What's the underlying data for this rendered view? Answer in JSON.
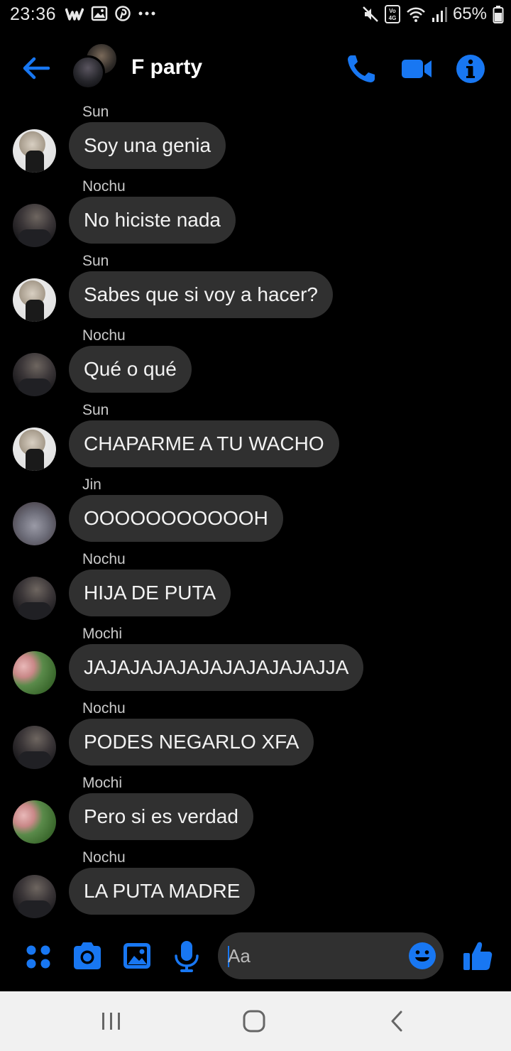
{
  "status_bar": {
    "time": "23:36",
    "battery_text": "65%",
    "left_icons": [
      "wattpad-icon",
      "gallery-icon",
      "pinterest-icon",
      "more-dots-icon"
    ],
    "right_icons": [
      "mute-icon",
      "volte-4g-icon",
      "wifi-icon",
      "signal-icon",
      "battery-icon"
    ]
  },
  "header": {
    "title": "F party",
    "icons": [
      "back-arrow-icon",
      "phone-icon",
      "video-icon",
      "info-icon"
    ]
  },
  "colors": {
    "accent": "#1877f2",
    "background": "#000000",
    "bubble": "#303030",
    "sender_label": "#c9c9c9",
    "navbar": "#f1f1f1"
  },
  "messages": [
    {
      "sender": "Sun",
      "text": "Soy una genia",
      "avatar": "sun"
    },
    {
      "sender": "Nochu",
      "text": "No hiciste nada",
      "avatar": "nochu"
    },
    {
      "sender": "Sun",
      "text": "Sabes que si voy a hacer?",
      "avatar": "sun"
    },
    {
      "sender": "Nochu",
      "text": "Qué o qué",
      "avatar": "nochu"
    },
    {
      "sender": "Sun",
      "text": "CHAPARME A TU WACHO",
      "avatar": "sun"
    },
    {
      "sender": "Jin",
      "text": "OOOOOOOOOOOH",
      "avatar": "jin"
    },
    {
      "sender": "Nochu",
      "text": "HIJA DE PUTA",
      "avatar": "nochu"
    },
    {
      "sender": "Mochi",
      "text": "JAJAJAJAJAJAJAJAJAJAJJA",
      "avatar": "mochi"
    },
    {
      "sender": "Nochu",
      "text": "PODES NEGARLO XFA",
      "avatar": "nochu"
    },
    {
      "sender": "Mochi",
      "text": "Pero si es verdad",
      "avatar": "mochi"
    },
    {
      "sender": "Nochu",
      "text": "LA PUTA MADRE",
      "avatar": "nochu"
    }
  ],
  "composer": {
    "placeholder": "Aa",
    "icons": [
      "apps-grid-icon",
      "camera-icon",
      "gallery-icon",
      "microphone-icon",
      "emoji-icon",
      "thumbs-up-icon"
    ]
  },
  "nav_bar": {
    "icons": [
      "recent-apps-icon",
      "home-icon",
      "back-icon"
    ]
  }
}
